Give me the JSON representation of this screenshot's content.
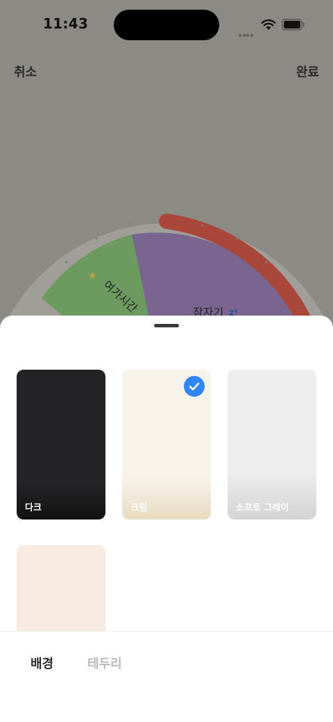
{
  "status_bar": {
    "time": "11:43"
  },
  "header": {
    "cancel_label": "취소",
    "done_label": "완료"
  },
  "wheel": {
    "segments": [
      {
        "label": "여가시간",
        "color": "#6d9a5f"
      },
      {
        "label": "잠자기",
        "color": "#7a6490"
      }
    ],
    "ring_color": "#9f9e99",
    "highlight_color": "#a8473a"
  },
  "sheet": {
    "themes": [
      {
        "label": "다크",
        "selected": false
      },
      {
        "label": "크림",
        "selected": true
      },
      {
        "label": "소프트 그레이",
        "selected": false
      },
      {
        "label": "",
        "selected": false
      }
    ],
    "tabs": [
      {
        "label": "배경",
        "active": true
      },
      {
        "label": "테두리",
        "active": false
      }
    ]
  },
  "colors": {
    "accent": "#2f86f4",
    "scrim": "#8b8a85"
  }
}
